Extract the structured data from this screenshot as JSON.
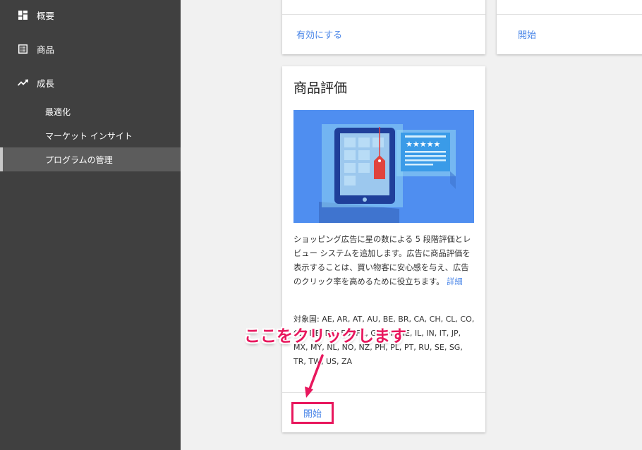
{
  "sidebar": {
    "items": [
      {
        "label": "概要",
        "icon": "dashboard-icon"
      },
      {
        "label": "商品",
        "icon": "list-icon"
      },
      {
        "label": "成長",
        "icon": "trending-up-icon"
      }
    ],
    "sub_items": [
      {
        "label": "最適化"
      },
      {
        "label": "マーケット インサイト"
      },
      {
        "label": "プログラムの管理",
        "active": true
      }
    ]
  },
  "top_cards": [
    {
      "action_label": "有効にする"
    },
    {
      "action_label": "開始"
    }
  ],
  "main_card": {
    "title": "商品評価",
    "description": "ショッピング広告に星の数による 5 段階評価とレビュー システムを追加します。広告に商品評価を表示することは、買い物客に安心感を与え、広告のクリック率を高めるために役立ちます。",
    "details_link": "詳細",
    "countries": "対象国: AE, AR, AT, AU, BE, BR, CA, CH, CL, CO, CZ, DE, DK, ES, FR, GB, HK, IE, IL, IN, IT, JP, MX, MY, NL, NO, NZ, PH, PL, PT, RU, SE, SG, TR, TW, US, ZA",
    "action_label": "開始"
  },
  "annotation": {
    "text": "ここをクリックします",
    "color": "#e8175d"
  },
  "colors": {
    "sidebar_bg": "#404040",
    "link": "#4a86e8",
    "hero_bg": "#4f8ef0"
  }
}
